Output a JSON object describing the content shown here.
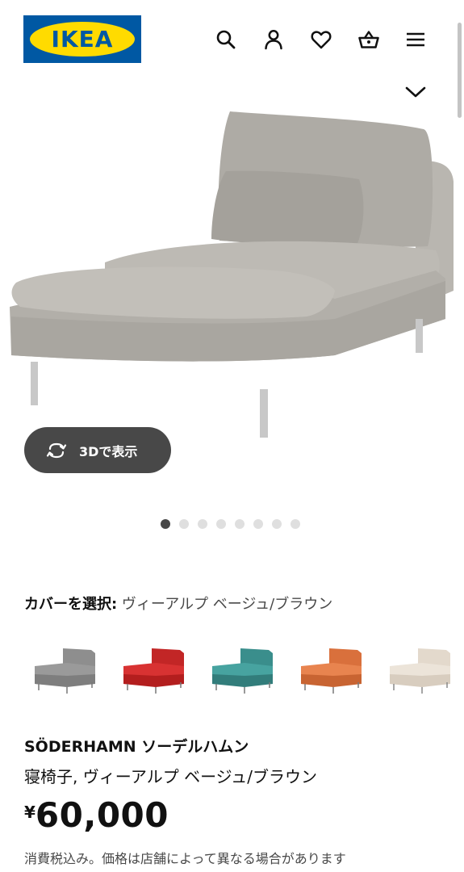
{
  "header": {
    "logo_text": "IKEA",
    "icons": [
      "search-icon",
      "user-icon",
      "heart-icon",
      "basket-icon",
      "menu-icon",
      "chevron-down-icon"
    ]
  },
  "gallery": {
    "view_3d_label": "3Dで表示",
    "dot_count": 8,
    "active_dot": 0
  },
  "cover": {
    "label": "カバーを選択:",
    "value": " ヴィーアルプ ベージュ/ブラウン",
    "swatch_colors": [
      "#8e8e8e",
      "#cc2a2a",
      "#3f9896",
      "#e07a45",
      "#e6dcd0"
    ]
  },
  "product": {
    "name": "SÖDERHAMN ソーデルハムン",
    "description": "寝椅子, ヴィーアルプ ベージュ/ブラウン",
    "currency": "¥",
    "price": "60,000",
    "tax_note": "消費税込み。価格は店舗によって異なる場合があります"
  },
  "colors": {
    "ikea_blue": "#0058a3",
    "ikea_yellow": "#ffdb00",
    "button_dark": "#484848"
  }
}
